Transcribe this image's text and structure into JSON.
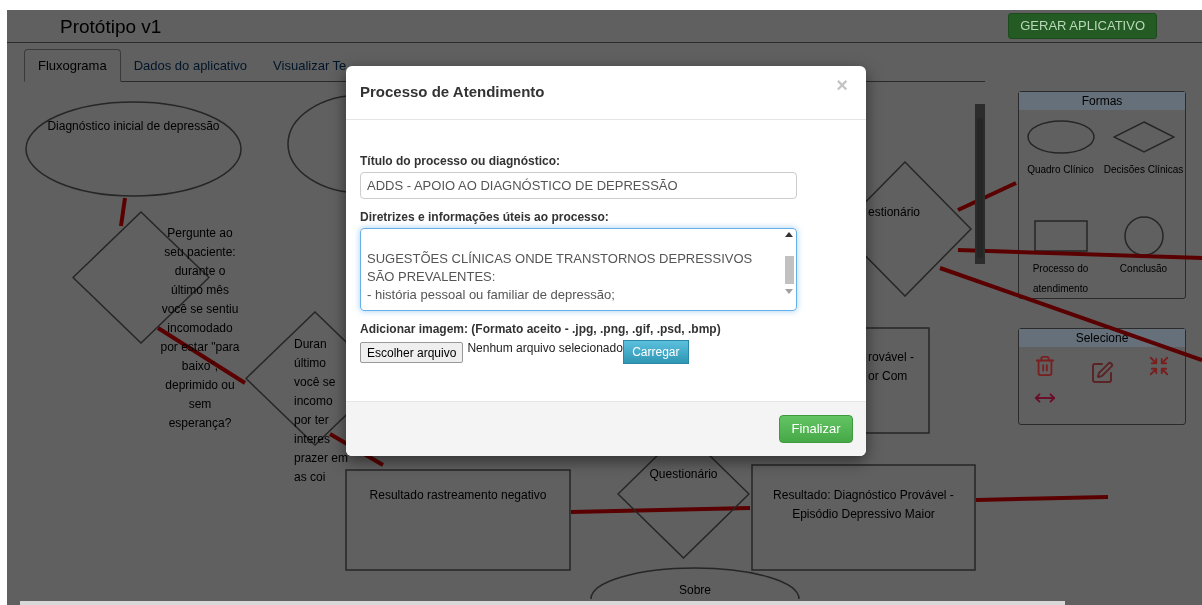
{
  "header": {
    "title": "Protótipo v1",
    "action_button": "GERAR APLICATIVO"
  },
  "tabs": [
    {
      "label": "Fluxograma",
      "selected": true
    },
    {
      "label": "Dados do aplicativo",
      "selected": false
    },
    {
      "label": "Visualizar Te",
      "selected": false
    }
  ],
  "flowchart": {
    "nodes": [
      {
        "kind": "ellipse",
        "lines": [
          "Diagnóstico inicial de depressão"
        ]
      },
      {
        "kind": "ellipse"
      },
      {
        "kind": "diamond",
        "lines": [
          "Pergunte ao",
          "seu paciente:",
          "durante o",
          "último mês",
          "você se sentiu",
          "incomodado",
          "por estar \"para",
          "baixo\",",
          "deprimido ou",
          "sem",
          "esperança?"
        ]
      },
      {
        "kind": "diamond",
        "lines": [
          "Duran",
          "último",
          "você se",
          "incomo",
          "por ter",
          "interes",
          "prazer em",
          "as coi"
        ]
      },
      {
        "kind": "rectangle",
        "lines": [
          "Resultado rastreamento negativo"
        ]
      },
      {
        "kind": "diamond",
        "lines": [
          "Questionário"
        ]
      },
      {
        "kind": "rectangle",
        "lines": [
          "Resultado: Diagnóstico Provável -",
          "Episódio Depressivo Maior"
        ]
      },
      {
        "kind": "ellipse",
        "lines": [
          "Sobre"
        ]
      },
      {
        "kind": "diamond",
        "lines": [
          "estionário"
        ]
      },
      {
        "kind": "rectangle",
        "lines": [
          "rovável -",
          "or Com"
        ]
      }
    ]
  },
  "shapes_panel": {
    "title": "Formas",
    "items": [
      {
        "kind": "ellipse",
        "label": "Quadro Clínico"
      },
      {
        "kind": "diamond",
        "label": "Decisões Clínicas"
      },
      {
        "kind": "rectangle",
        "label": "Processo do atendimento"
      },
      {
        "kind": "circle",
        "label": "Conclusão"
      }
    ]
  },
  "select_panel": {
    "title": "Selecione"
  },
  "dialog": {
    "title": "Processo de Atendimento",
    "close": "×",
    "title_field": {
      "label": "Título do processo ou diagnóstico:",
      "value": "ADDS - APOIO AO DIAGNÓSTICO DE DEPRESSÃO"
    },
    "notes_field": {
      "label": "Diretrizes e informações úteis ao processo:",
      "lines": [
        "SUGESTÕES CLÍNICAS ONDE TRANSTORNOS DEPRESSIVOS",
        "SÃO PREVALENTES:",
        "- história pessoal ou familiar de depressão;"
      ]
    },
    "image_field": {
      "label": "Adicionar imagem: (Formato aceito - .jpg, .png, .gif, .psd, .bmp)",
      "choose_button": "Escolher arquivo",
      "status": "Nenhum arquivo selecionado",
      "upload_button": "Carregar"
    },
    "primary_button": "Finalizar"
  }
}
